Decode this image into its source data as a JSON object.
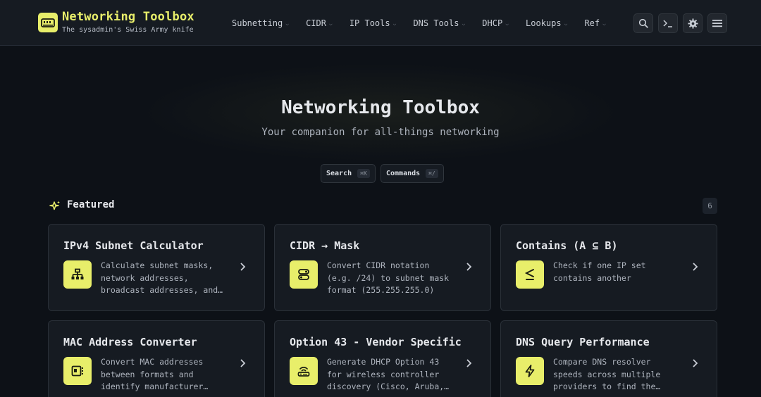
{
  "app": {
    "title": "Networking Toolbox",
    "tagline": "The sysadmin's Swiss Army knife"
  },
  "nav": [
    {
      "label": "Subnetting"
    },
    {
      "label": "CIDR"
    },
    {
      "label": "IP Tools"
    },
    {
      "label": "DNS Tools"
    },
    {
      "label": "DHCP"
    },
    {
      "label": "Lookups"
    },
    {
      "label": "Ref"
    }
  ],
  "header_buttons": [
    "search-icon",
    "terminal-icon",
    "gear-icon",
    "menu-icon"
  ],
  "hero": {
    "title": "Networking Toolbox",
    "subtitle": "Your companion for all-things networking",
    "search": {
      "label": "Search",
      "shortcut": "⌘K"
    },
    "commands": {
      "label": "Commands",
      "shortcut": "⌘/"
    }
  },
  "featured": {
    "label": "Featured",
    "count": "6",
    "cards": [
      {
        "title": "IPv4 Subnet Calculator",
        "icon": "network-tree-icon",
        "desc": [
          "Calculate subnet masks,",
          "network addresses,",
          "broadcast addresses, and…"
        ]
      },
      {
        "title": "CIDR → Mask",
        "icon": "toggle-icon",
        "desc": [
          "Convert CIDR notation",
          "(e.g. /24) to subnet mask",
          "format (255.255.255.0)"
        ]
      },
      {
        "title": "Contains (A ⊆ B)",
        "icon": "less-equal-icon",
        "desc": [
          "Check if one IP set",
          "contains another"
        ]
      },
      {
        "title": "MAC Address Converter",
        "icon": "nic-icon",
        "desc": [
          "Convert MAC addresses",
          "between formats and",
          "identify manufacturer…"
        ]
      },
      {
        "title": "Option 43 - Vendor Specific",
        "icon": "router-icon",
        "desc": [
          "Generate DHCP Option 43",
          "for wireless controller",
          "discovery (Cisco, Aruba,…"
        ]
      },
      {
        "title": "DNS Query Performance",
        "icon": "lightning-icon",
        "desc": [
          "Compare DNS resolver",
          "speeds across multiple",
          "providers to find the…"
        ]
      }
    ]
  },
  "colors": {
    "accent": "#e8ee6a",
    "background": "#0d1117",
    "surface": "#161b22"
  }
}
